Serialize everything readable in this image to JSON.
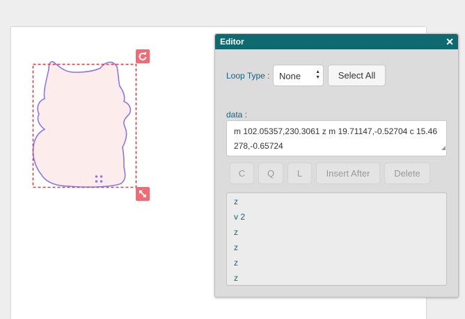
{
  "editor": {
    "title": "Editor",
    "close_icon": "close-icon",
    "loop_type_label": "Loop Type :",
    "loop_type_value": "None",
    "select_all_label": "Select All",
    "data_label": "data :",
    "data_value": "m 102.05357,230.3061 z m 19.71147,-0.52704 c 15.46278,-0.65724",
    "buttons": {
      "c": "C",
      "q": "Q",
      "l": "L",
      "insert_after": "Insert After",
      "delete": "Delete"
    },
    "commands": [
      "z",
      "v 2",
      "z",
      "z",
      "z",
      "z"
    ]
  },
  "canvas": {
    "shape": "cat-silhouette",
    "shape_fill": "#fdecec",
    "shape_stroke": "#8a77e6",
    "selection_color": "#e8323a",
    "handle_color": "#f06b73",
    "rotate_icon": "rotate-icon",
    "resize_icon": "resize-icon"
  }
}
